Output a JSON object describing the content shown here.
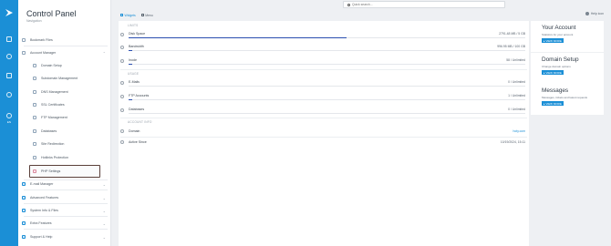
{
  "rail": {
    "label": "EN"
  },
  "sidebar": {
    "title": "Control Panel",
    "subtitle": "Navigation",
    "bookmark": "Bookmark Files",
    "items": [
      {
        "label": "Account Manager",
        "chevron": "⌃",
        "icon": "user-icon"
      },
      {
        "label": "Domain Setup",
        "icon": "globe-icon"
      },
      {
        "label": "Subdomain Management",
        "icon": "subdomain-icon"
      },
      {
        "label": "DNS Management",
        "icon": "dns-icon"
      },
      {
        "label": "SSL Certificates",
        "icon": "lock-icon"
      },
      {
        "label": "FTP Management",
        "icon": "folder-icon"
      },
      {
        "label": "Databases",
        "icon": "database-icon"
      },
      {
        "label": "Site Redirection",
        "icon": "redirect-icon"
      },
      {
        "label": "Hotlinks Protection",
        "icon": "shield-icon"
      },
      {
        "label": "PHP Settings",
        "icon": "php-icon"
      },
      {
        "label": "E-mail Manager",
        "chevron": "⌄",
        "icon": "mail-icon"
      },
      {
        "label": "Advanced Features",
        "chevron": "⌄",
        "icon": "advanced-icon"
      },
      {
        "label": "System Info & Files",
        "chevron": "⌄",
        "icon": "info-icon"
      },
      {
        "label": "Extra Features",
        "chevron": "⌄",
        "icon": "extra-icon"
      },
      {
        "label": "Support & Help",
        "chevron": "⌄",
        "icon": "help-icon"
      }
    ]
  },
  "topbar": {
    "search_placeholder": "Quick search..."
  },
  "tabs": [
    {
      "label": "Widgets"
    },
    {
      "label": "Menu"
    }
  ],
  "help": {
    "label": "Help icon"
  },
  "panel": {
    "limits_heading": "LIMITS",
    "usage_heading": "USAGE",
    "info_heading": "ACCOUNT INFO",
    "limits": [
      {
        "label": "Disk Space",
        "value": "2791.48 MB / 5 GB",
        "fraction": 0.55
      },
      {
        "label": "Bandwidth",
        "value": "996.95 MB / 100 GB",
        "fraction": 0.01
      },
      {
        "label": "Inode",
        "value": "58 / Unlimited",
        "fraction": 0.01
      }
    ],
    "usage": [
      {
        "label": "E-Mails",
        "value": "0 / Unlimited",
        "fraction": 0.0
      },
      {
        "label": "FTP Accounts",
        "value": "1 / Unlimited",
        "fraction": 0.01
      },
      {
        "label": "Databases",
        "value": "0 / Unlimited",
        "fraction": 0.0
      }
    ],
    "info": [
      {
        "label": "Domain",
        "value": "hoty.com"
      },
      {
        "label": "Active Since",
        "value": "10/19/2024, 15:11"
      }
    ]
  },
  "cards": [
    {
      "title": "Your Account",
      "subtitle": "Statistics for your account",
      "button": "▸ VIEW MORE"
    },
    {
      "title": "Domain Setup",
      "subtitle": "Change domain options",
      "button": "▸ VIEW MORE"
    },
    {
      "title": "Messages",
      "subtitle": "Messages, tickets and latest requests",
      "button": "▸ VIEW MORE"
    }
  ],
  "colors": {
    "accent": "#1b8fd6",
    "bar": "#2b4fb0",
    "selected_border": "#5a3f3a"
  }
}
